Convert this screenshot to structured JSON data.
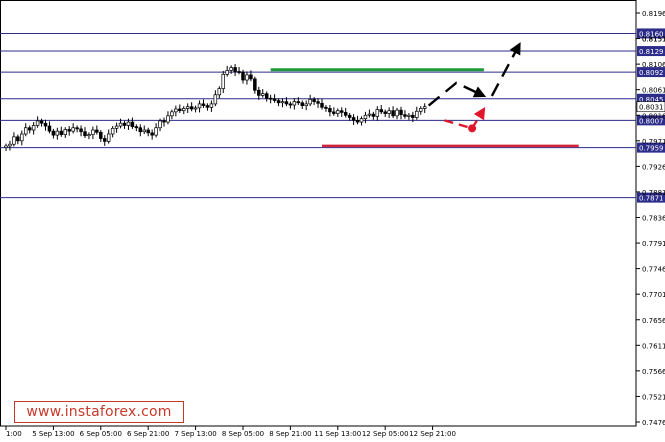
{
  "colors": {
    "background": "#ffffff",
    "grid": "#c9cbe6",
    "price_line": "#2c2c8a",
    "candle": "#000000",
    "support": "#d4243a",
    "resistance": "#1f9a3a",
    "arrow_black": "#000000",
    "arrow_red": "#e0162b",
    "current_label_bg": "#ffffff",
    "level_label_bg": "#2c2c8a",
    "watermark": "#c8392b"
  },
  "watermark": {
    "text": "www.instaforex.com",
    "brackets": "[   ]"
  },
  "chart_data": {
    "type": "candlestick",
    "title": "",
    "xlabel": "",
    "ylabel": "",
    "ylim": [
      0.7476,
      0.8196
    ],
    "grid": false,
    "y_ticks": [
      "0.8196",
      "0.8151",
      "0.8106",
      "0.8061",
      "0.8016",
      "0.7971",
      "0.7926",
      "0.7881",
      "0.7836",
      "0.7791",
      "0.7746",
      "0.7701",
      "0.7656",
      "0.7611",
      "0.7566",
      "0.7521",
      "0.7476"
    ],
    "x_ticks": [
      {
        "label": "1:00",
        "i": 0
      },
      {
        "label": "5 Sep 13:00",
        "i": 12
      },
      {
        "label": "6 Sep 05:00",
        "i": 24
      },
      {
        "label": "6 Sep 21:00",
        "i": 36
      },
      {
        "label": "7 Sep 13:00",
        "i": 48
      },
      {
        "label": "8 Sep 05:00",
        "i": 60
      },
      {
        "label": "8 Sep 21:00",
        "i": 72
      },
      {
        "label": "11 Sep 13:00",
        "i": 84
      },
      {
        "label": "12 Sep 05:00",
        "i": 96
      },
      {
        "label": "12 Sep 21:00",
        "i": 108
      }
    ],
    "levels": [
      {
        "value": 0.816,
        "label": "0.8160"
      },
      {
        "value": 0.8129,
        "label": "0.8129"
      },
      {
        "value": 0.8092,
        "label": "0.8092"
      },
      {
        "value": 0.8045,
        "label": "0.8045"
      },
      {
        "value": 0.8007,
        "label": "0.8007"
      },
      {
        "value": 0.7959,
        "label": "0.7959"
      },
      {
        "value": 0.7871,
        "label": "0.7871"
      }
    ],
    "current_price": {
      "value": 0.8031,
      "label": "0.8031"
    },
    "extra_labels": [
      {
        "value": 0.8151,
        "label": "0.8151"
      }
    ],
    "resistance_zone": {
      "value": 0.8096,
      "from_i": 67,
      "to_i": 121
    },
    "support_zone": {
      "value": 0.7962,
      "from_i": 80,
      "to_i": 145
    },
    "close": [
      0.7962,
      0.7965,
      0.7978,
      0.7971,
      0.7983,
      0.7994,
      0.799,
      0.7998,
      0.8006,
      0.8002,
      0.7997,
      0.7988,
      0.7981,
      0.7988,
      0.7982,
      0.7991,
      0.7988,
      0.7994,
      0.7992,
      0.7987,
      0.798,
      0.7982,
      0.799,
      0.7986,
      0.7975,
      0.797,
      0.7983,
      0.7993,
      0.7997,
      0.8002,
      0.7998,
      0.8004,
      0.7996,
      0.7994,
      0.7987,
      0.799,
      0.7985,
      0.7981,
      0.7994,
      0.8006,
      0.8004,
      0.8015,
      0.8022,
      0.8027,
      0.8024,
      0.8028,
      0.8031,
      0.8027,
      0.8029,
      0.8036,
      0.8033,
      0.803,
      0.8036,
      0.8052,
      0.8063,
      0.8088,
      0.8095,
      0.81,
      0.8093,
      0.8092,
      0.8078,
      0.8087,
      0.808,
      0.806,
      0.8051,
      0.8054,
      0.8046,
      0.8045,
      0.8042,
      0.8038,
      0.804,
      0.8036,
      0.8034,
      0.804,
      0.8038,
      0.8033,
      0.8036,
      0.8044,
      0.804,
      0.8037,
      0.803,
      0.8028,
      0.8022,
      0.8019,
      0.8024,
      0.8021,
      0.8016,
      0.8012,
      0.8007,
      0.8004,
      0.801,
      0.8016,
      0.8018,
      0.8014,
      0.8026,
      0.8022,
      0.8019,
      0.8024,
      0.8015,
      0.8025,
      0.8017,
      0.8014,
      0.8016,
      0.8012,
      0.8023,
      0.8028,
      0.8031
    ]
  }
}
